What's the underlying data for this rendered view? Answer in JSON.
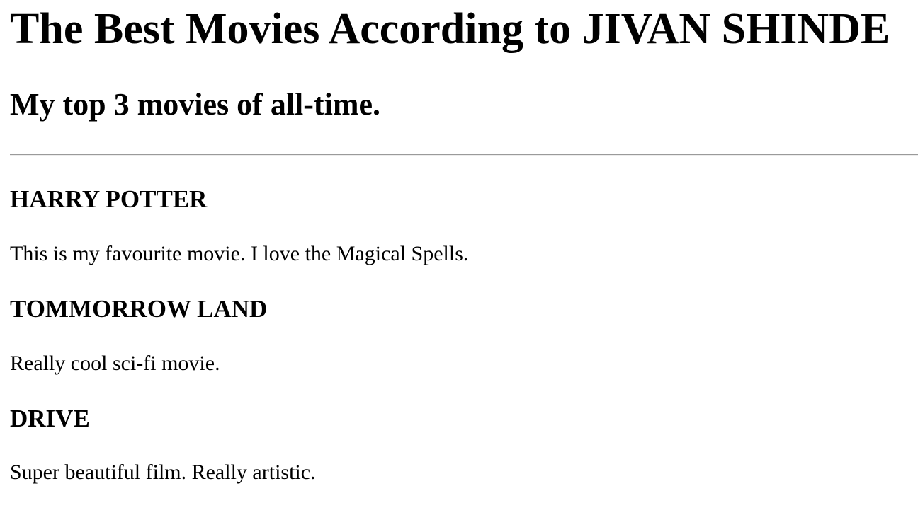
{
  "page": {
    "title": "The Best Movies According to JIVAN SHINDE",
    "subtitle": "My top 3 movies of all-time."
  },
  "movies": [
    {
      "title": "HARRY POTTER",
      "description": "This is my favourite movie. I love the Magical Spells."
    },
    {
      "title": "TOMMORROW LAND",
      "description": "Really cool sci-fi movie."
    },
    {
      "title": "DRIVE",
      "description": "Super beautiful film. Really artistic."
    }
  ]
}
